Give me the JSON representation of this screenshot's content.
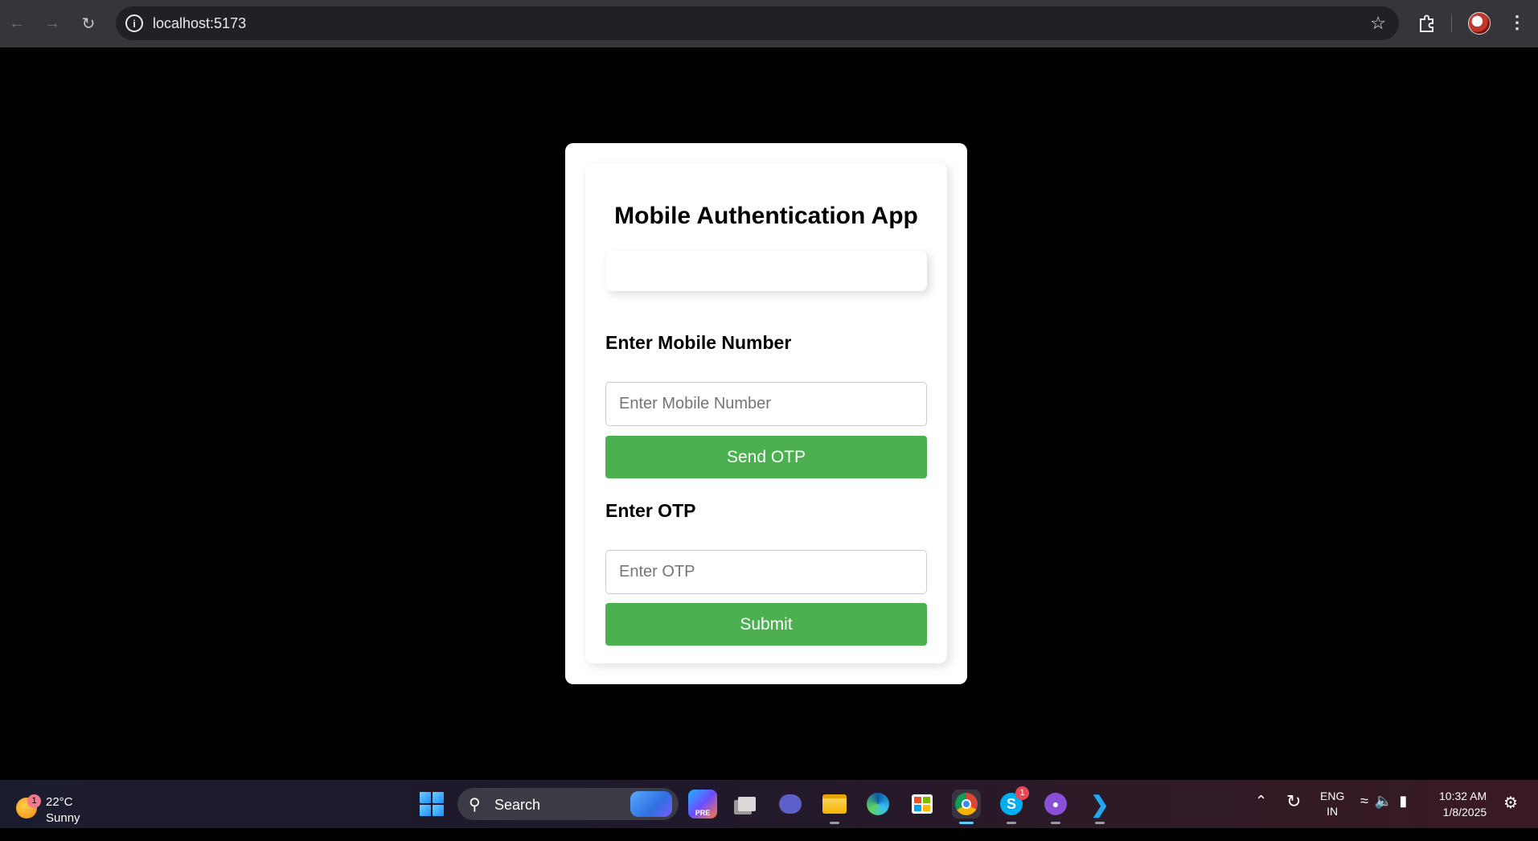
{
  "browser": {
    "url": "localhost:5173",
    "back_icon": "arrow-left-icon",
    "forward_icon": "arrow-right-icon",
    "reload_icon": "reload-icon",
    "info_icon": "info-icon",
    "bookmark_icon": "star-icon",
    "extensions_icon": "puzzle-icon",
    "menu_icon": "kebab-menu-icon"
  },
  "app": {
    "title": "Mobile Authentication App",
    "mobile_label": "Enter Mobile Number",
    "mobile_placeholder": "Enter Mobile Number",
    "mobile_value": "",
    "send_otp_label": "Send OTP",
    "otp_label": "Enter OTP",
    "otp_placeholder": "Enter OTP",
    "otp_value": "",
    "submit_label": "Submit",
    "button_color": "#4caf50"
  },
  "taskbar": {
    "weather": {
      "temp": "22°C",
      "condition": "Sunny",
      "badge": "1"
    },
    "search_label": "Search",
    "apps": [
      {
        "name": "copilot",
        "icon": "copilot-icon",
        "badge": ""
      },
      {
        "name": "task-view",
        "icon": "task-view-icon",
        "badge": ""
      },
      {
        "name": "teams",
        "icon": "teams-icon",
        "badge": ""
      },
      {
        "name": "file-explorer",
        "icon": "folder-icon",
        "badge": ""
      },
      {
        "name": "edge",
        "icon": "edge-icon",
        "badge": ""
      },
      {
        "name": "store",
        "icon": "store-icon",
        "badge": ""
      },
      {
        "name": "chrome",
        "icon": "chrome-icon",
        "badge": ""
      },
      {
        "name": "skype",
        "icon": "skype-icon",
        "badge": "1"
      },
      {
        "name": "github-desktop",
        "icon": "github-icon",
        "badge": ""
      },
      {
        "name": "vscode",
        "icon": "vscode-icon",
        "badge": ""
      }
    ],
    "lang_line1": "ENG",
    "lang_line2": "IN",
    "time": "10:32 AM",
    "date": "1/8/2025"
  }
}
